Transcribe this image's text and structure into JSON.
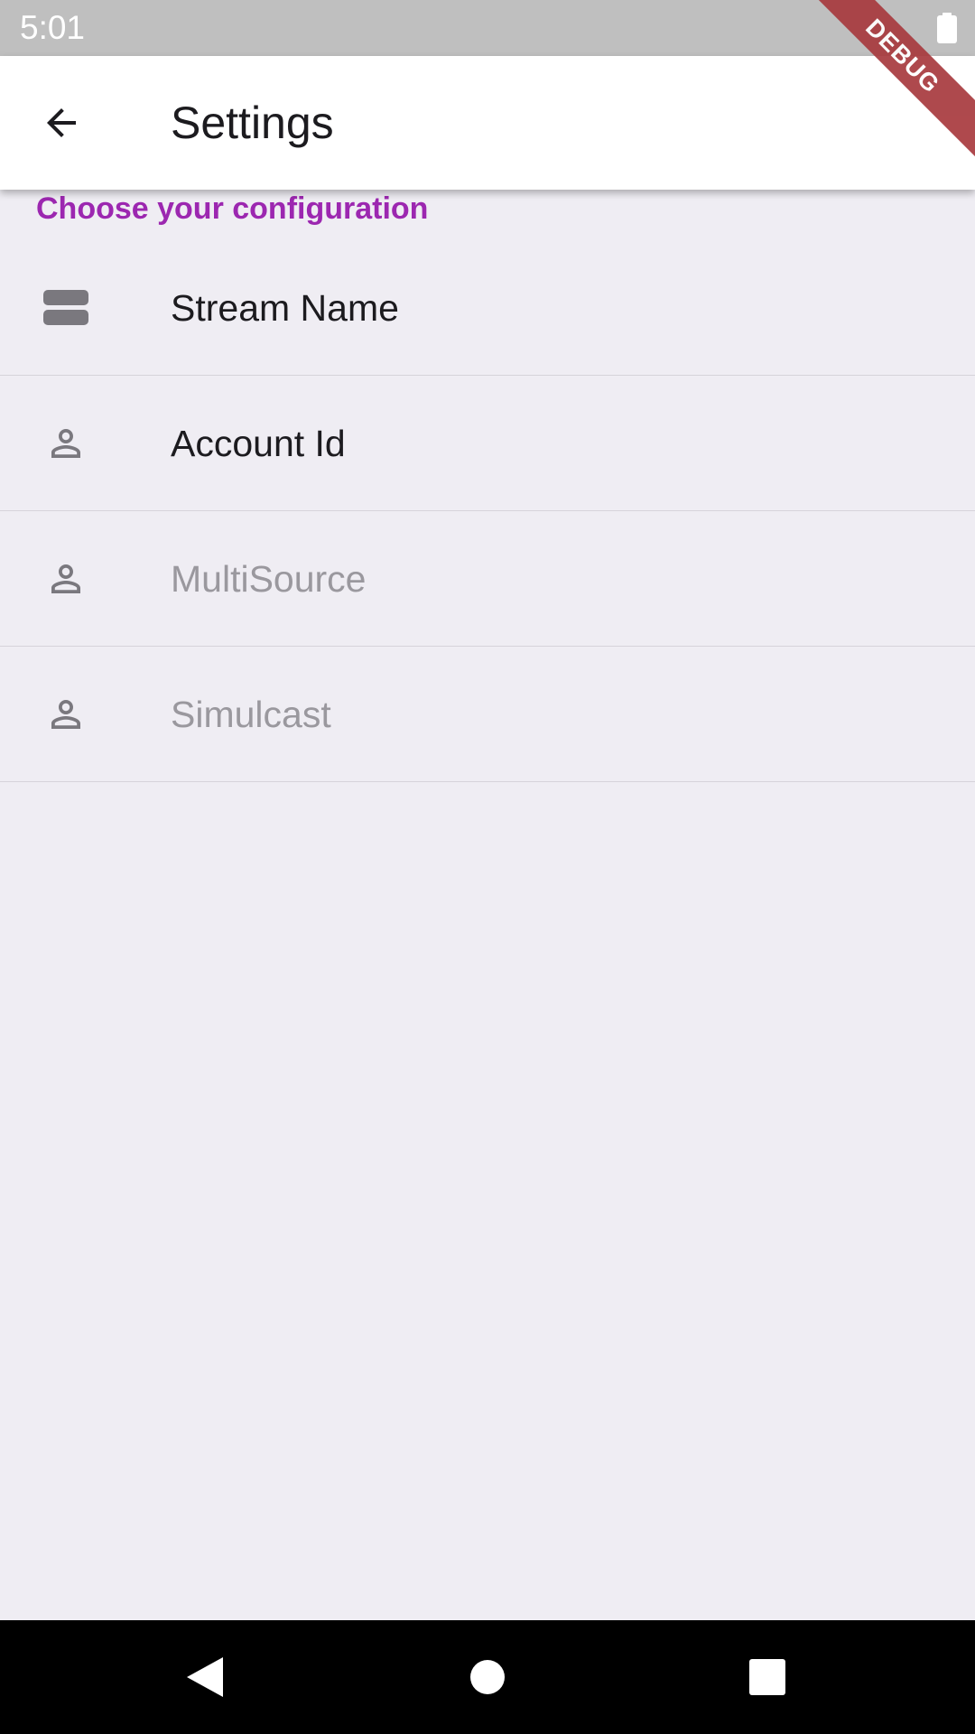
{
  "status_bar": {
    "time": "5:01",
    "battery_icon": "battery-full-icon"
  },
  "debug_banner": {
    "label": "DEBUG",
    "color": "#a83a3e"
  },
  "app_bar": {
    "title": "Settings",
    "back_icon": "arrow-back-icon"
  },
  "section": {
    "header": "Choose your configuration",
    "header_color": "#9c27b0"
  },
  "items": [
    {
      "label": "Stream Name",
      "icon": "storage-icon",
      "enabled": true
    },
    {
      "label": "Account Id",
      "icon": "person-outline-icon",
      "enabled": true
    },
    {
      "label": "MultiSource",
      "icon": "person-outline-icon",
      "enabled": false
    },
    {
      "label": "Simulcast",
      "icon": "person-outline-icon",
      "enabled": false
    }
  ],
  "nav_bar": {
    "back_icon": "nav-back-triangle-icon",
    "home_icon": "nav-home-circle-icon",
    "recents_icon": "nav-recents-square-icon"
  },
  "colors": {
    "background": "#efedf3",
    "status_bar": "#bfbfbf",
    "app_bar": "#ffffff",
    "text_primary": "#1c1b1f",
    "text_disabled": "#9a989e",
    "icon": "#7a787e"
  }
}
